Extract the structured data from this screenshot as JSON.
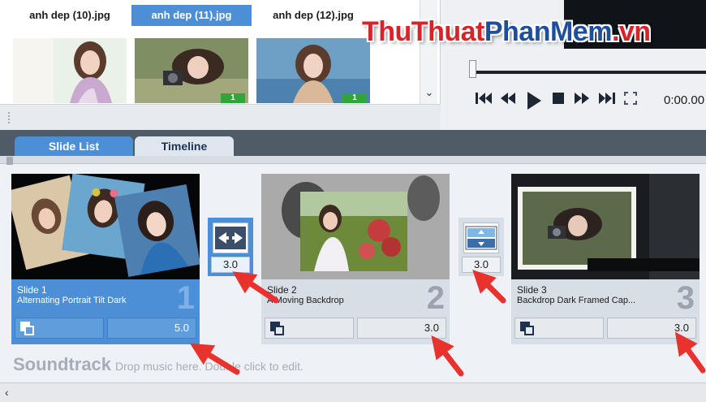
{
  "file_browser": {
    "tabs": [
      {
        "label": "anh dep (10).jpg"
      },
      {
        "label": "anh dep (11).jpg"
      },
      {
        "label": "anh dep (12).jpg"
      }
    ],
    "badges": [
      "1",
      "1"
    ]
  },
  "player": {
    "time": "0:00.00"
  },
  "watermark": {
    "part1": "ThuThuat",
    "part2": "PhanMem",
    "part3": ".vn"
  },
  "tabs": {
    "slide_list": "Slide List",
    "timeline": "Timeline"
  },
  "slides": [
    {
      "name": "Slide 1",
      "description": "Alternating Portrait Tilt Dark",
      "number": "1",
      "duration": "5.0"
    },
    {
      "name": "Slide 2",
      "description": "A Moving Backdrop",
      "number": "2",
      "duration": "3.0"
    },
    {
      "name": "Slide 3",
      "description": "Backdrop Dark Framed Cap...",
      "number": "3",
      "duration": "3.0"
    }
  ],
  "transitions": [
    {
      "duration": "3.0"
    },
    {
      "duration": "3.0"
    }
  ],
  "soundtrack": {
    "title": "Soundtrack",
    "hint": "Drop music here. Double click to edit."
  },
  "icons": {
    "scroll_down": "chevron-down-icon",
    "scroll_left": "chevron-left-icon",
    "controls": [
      "skip-start-icon",
      "rewind-icon",
      "play-icon",
      "stop-icon",
      "fast-forward-icon",
      "skip-end-icon",
      "fullscreen-icon"
    ]
  },
  "colors": {
    "accent": "#4d8fd6",
    "annotation_arrow": "#e8322e",
    "watermark_red": "#d8232a",
    "watermark_blue": "#1f4e9a"
  }
}
